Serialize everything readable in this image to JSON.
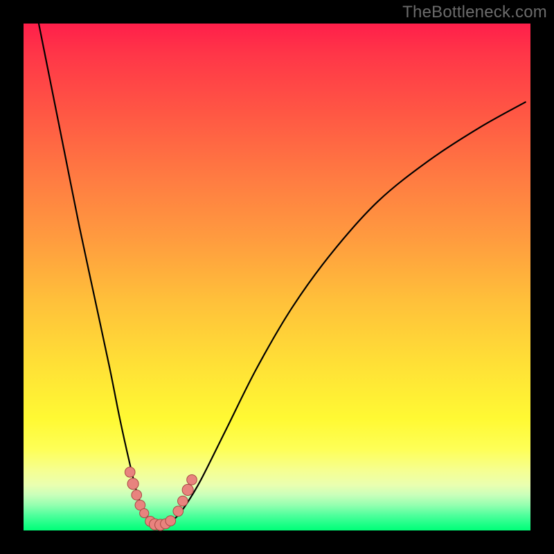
{
  "watermark": "TheBottleneck.com",
  "colors": {
    "frame_bg": "#000000",
    "marker_fill": "#e8837e",
    "marker_stroke": "#a84843",
    "curve_stroke": "#000000",
    "gradient_top": "#ff1f4a",
    "gradient_bottom": "#00ff78"
  },
  "chart_data": {
    "type": "line",
    "title": "",
    "xlabel": "",
    "ylabel": "",
    "xlim": [
      0,
      100
    ],
    "ylim": [
      0,
      100
    ],
    "note": "Axes are unmarked; values are normalized percentages of the plot area (0 = left/bottom, 100 = right/top).",
    "series": [
      {
        "name": "left-branch",
        "x": [
          3,
          5,
          8,
          11,
          14,
          17,
          19,
          21,
          22.5,
          24,
          25.2,
          26
        ],
        "y": [
          100,
          90,
          75,
          60,
          46,
          32,
          22,
          13,
          7,
          3.5,
          1.8,
          1.2
        ]
      },
      {
        "name": "right-branch",
        "x": [
          26,
          28,
          30,
          32,
          35,
          40,
          46,
          53,
          61,
          70,
          80,
          90,
          99
        ],
        "y": [
          1.2,
          1.5,
          2.5,
          5,
          10,
          20,
          32,
          44,
          55,
          65,
          73,
          79.5,
          84.5
        ]
      }
    ],
    "markers": [
      {
        "name": "left-cluster-upper-1",
        "x": 21.0,
        "y": 11.5,
        "r": 1.0
      },
      {
        "name": "left-cluster-upper-2",
        "x": 21.6,
        "y": 9.2,
        "r": 1.1
      },
      {
        "name": "left-cluster-upper-3",
        "x": 22.3,
        "y": 7.0,
        "r": 1.0
      },
      {
        "name": "left-cluster-lower-1",
        "x": 23.0,
        "y": 5.0,
        "r": 1.0
      },
      {
        "name": "left-cluster-lower-2",
        "x": 23.8,
        "y": 3.4,
        "r": 0.9
      },
      {
        "name": "bottom-1",
        "x": 25.0,
        "y": 1.8,
        "r": 1.0
      },
      {
        "name": "bottom-2",
        "x": 25.9,
        "y": 1.2,
        "r": 1.1
      },
      {
        "name": "bottom-3",
        "x": 27.0,
        "y": 1.1,
        "r": 1.1
      },
      {
        "name": "bottom-4",
        "x": 28.0,
        "y": 1.3,
        "r": 1.0
      },
      {
        "name": "bottom-5",
        "x": 29.0,
        "y": 1.9,
        "r": 1.0
      },
      {
        "name": "right-cluster-1",
        "x": 30.5,
        "y": 3.8,
        "r": 1.0
      },
      {
        "name": "right-cluster-2",
        "x": 31.4,
        "y": 5.8,
        "r": 1.0
      },
      {
        "name": "right-cluster-3",
        "x": 32.4,
        "y": 8.0,
        "r": 1.1
      },
      {
        "name": "right-cluster-4",
        "x": 33.2,
        "y": 10.0,
        "r": 1.0
      }
    ]
  }
}
